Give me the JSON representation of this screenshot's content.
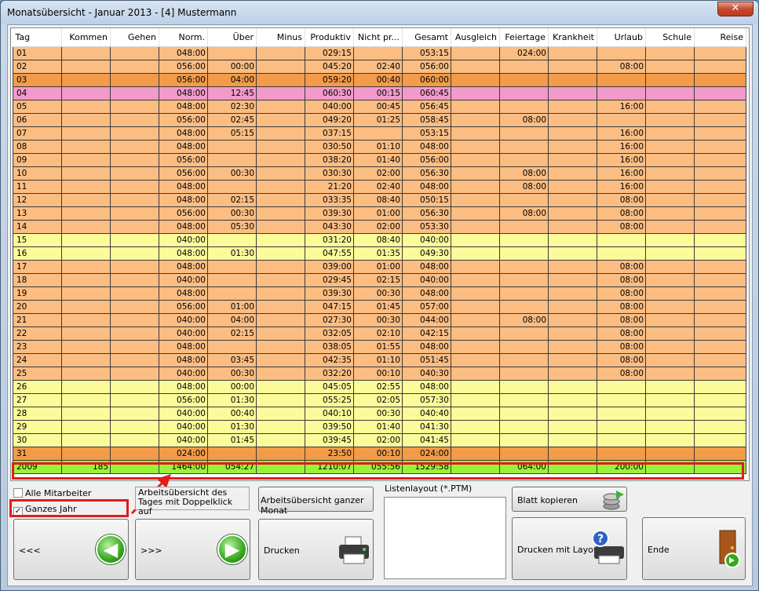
{
  "window": {
    "title": "Monatsübersicht - Januar 2013 - [4] Mustermann",
    "close_label": "✕"
  },
  "columns": [
    "Tag",
    "Kommen",
    "Gehen",
    "Norm.",
    "Über",
    "Minus",
    "Produktiv",
    "Nicht pr...",
    "Gesamt",
    "Ausgleich",
    "Feiertage",
    "Krankheit",
    "Urlaub",
    "Schule",
    "Reise"
  ],
  "rows": [
    {
      "color": "orange",
      "cells": [
        "01",
        "",
        "",
        "048:00",
        "",
        "",
        "029:15",
        "",
        "053:15",
        "",
        "024:00",
        "",
        "",
        "",
        ""
      ]
    },
    {
      "color": "orange",
      "cells": [
        "02",
        "",
        "",
        "056:00",
        "00:00",
        "",
        "045:20",
        "02:40",
        "056:00",
        "",
        "",
        "",
        "08:00",
        "",
        ""
      ]
    },
    {
      "color": "dark",
      "cells": [
        "03",
        "",
        "",
        "056:00",
        "04:00",
        "",
        "059:20",
        "00:40",
        "060:00",
        "",
        "",
        "",
        "",
        "",
        ""
      ]
    },
    {
      "color": "pink",
      "cells": [
        "04",
        "",
        "",
        "048:00",
        "12:45",
        "",
        "060:30",
        "00:15",
        "060:45",
        "",
        "",
        "",
        "",
        "",
        ""
      ]
    },
    {
      "color": "orange",
      "cells": [
        "05",
        "",
        "",
        "048:00",
        "02:30",
        "",
        "040:00",
        "00:45",
        "056:45",
        "",
        "",
        "",
        "16:00",
        "",
        ""
      ]
    },
    {
      "color": "orange",
      "cells": [
        "06",
        "",
        "",
        "056:00",
        "02:45",
        "",
        "049:20",
        "01:25",
        "058:45",
        "",
        "08:00",
        "",
        "",
        "",
        ""
      ]
    },
    {
      "color": "orange",
      "cells": [
        "07",
        "",
        "",
        "048:00",
        "05:15",
        "",
        "037:15",
        "",
        "053:15",
        "",
        "",
        "",
        "16:00",
        "",
        ""
      ]
    },
    {
      "color": "orange",
      "cells": [
        "08",
        "",
        "",
        "048:00",
        "",
        "",
        "030:50",
        "01:10",
        "048:00",
        "",
        "",
        "",
        "16:00",
        "",
        ""
      ]
    },
    {
      "color": "orange",
      "cells": [
        "09",
        "",
        "",
        "056:00",
        "",
        "",
        "038:20",
        "01:40",
        "056:00",
        "",
        "",
        "",
        "16:00",
        "",
        ""
      ]
    },
    {
      "color": "orange",
      "cells": [
        "10",
        "",
        "",
        "056:00",
        "00:30",
        "",
        "030:30",
        "02:00",
        "056:30",
        "",
        "08:00",
        "",
        "16:00",
        "",
        ""
      ]
    },
    {
      "color": "orange",
      "cells": [
        "11",
        "",
        "",
        "048:00",
        "",
        "",
        "21:20",
        "02:40",
        "048:00",
        "",
        "08:00",
        "",
        "16:00",
        "",
        ""
      ]
    },
    {
      "color": "orange",
      "cells": [
        "12",
        "",
        "",
        "048:00",
        "02:15",
        "",
        "033:35",
        "08:40",
        "050:15",
        "",
        "",
        "",
        "08:00",
        "",
        ""
      ]
    },
    {
      "color": "orange",
      "cells": [
        "13",
        "",
        "",
        "056:00",
        "00:30",
        "",
        "039:30",
        "01:00",
        "056:30",
        "",
        "08:00",
        "",
        "08:00",
        "",
        ""
      ]
    },
    {
      "color": "orange",
      "cells": [
        "14",
        "",
        "",
        "048:00",
        "05:30",
        "",
        "043:30",
        "02:00",
        "053:30",
        "",
        "",
        "",
        "08:00",
        "",
        ""
      ]
    },
    {
      "color": "yellow",
      "cells": [
        "15",
        "",
        "",
        "040:00",
        "",
        "",
        "031:20",
        "08:40",
        "040:00",
        "",
        "",
        "",
        "",
        "",
        ""
      ]
    },
    {
      "color": "yellow",
      "cells": [
        "16",
        "",
        "",
        "048:00",
        "01:30",
        "",
        "047:55",
        "01:35",
        "049:30",
        "",
        "",
        "",
        "",
        "",
        ""
      ]
    },
    {
      "color": "orange",
      "cells": [
        "17",
        "",
        "",
        "048:00",
        "",
        "",
        "039:00",
        "01:00",
        "048:00",
        "",
        "",
        "",
        "08:00",
        "",
        ""
      ]
    },
    {
      "color": "orange",
      "cells": [
        "18",
        "",
        "",
        "040:00",
        "",
        "",
        "029:45",
        "02:15",
        "040:00",
        "",
        "",
        "",
        "08:00",
        "",
        ""
      ]
    },
    {
      "color": "orange",
      "cells": [
        "19",
        "",
        "",
        "048:00",
        "",
        "",
        "039:30",
        "00:30",
        "048:00",
        "",
        "",
        "",
        "08:00",
        "",
        ""
      ]
    },
    {
      "color": "orange",
      "cells": [
        "20",
        "",
        "",
        "056:00",
        "01:00",
        "",
        "047:15",
        "01:45",
        "057:00",
        "",
        "",
        "",
        "08:00",
        "",
        ""
      ]
    },
    {
      "color": "orange",
      "cells": [
        "21",
        "",
        "",
        "040:00",
        "04:00",
        "",
        "027:30",
        "00:30",
        "044:00",
        "",
        "08:00",
        "",
        "08:00",
        "",
        ""
      ]
    },
    {
      "color": "orange",
      "cells": [
        "22",
        "",
        "",
        "040:00",
        "02:15",
        "",
        "032:05",
        "02:10",
        "042:15",
        "",
        "",
        "",
        "08:00",
        "",
        ""
      ]
    },
    {
      "color": "orange",
      "cells": [
        "23",
        "",
        "",
        "048:00",
        "",
        "",
        "038:05",
        "01:55",
        "048:00",
        "",
        "",
        "",
        "08:00",
        "",
        ""
      ]
    },
    {
      "color": "orange",
      "cells": [
        "24",
        "",
        "",
        "048:00",
        "03:45",
        "",
        "042:35",
        "01:10",
        "051:45",
        "",
        "",
        "",
        "08:00",
        "",
        ""
      ]
    },
    {
      "color": "orange",
      "cells": [
        "25",
        "",
        "",
        "040:00",
        "00:30",
        "",
        "032:20",
        "00:10",
        "040:30",
        "",
        "",
        "",
        "08:00",
        "",
        ""
      ]
    },
    {
      "color": "yellow",
      "cells": [
        "26",
        "",
        "",
        "048:00",
        "00:00",
        "",
        "045:05",
        "02:55",
        "048:00",
        "",
        "",
        "",
        "",
        "",
        ""
      ]
    },
    {
      "color": "yellow",
      "cells": [
        "27",
        "",
        "",
        "056:00",
        "01:30",
        "",
        "055:25",
        "02:05",
        "057:30",
        "",
        "",
        "",
        "",
        "",
        ""
      ]
    },
    {
      "color": "yellow",
      "cells": [
        "28",
        "",
        "",
        "040:00",
        "00:40",
        "",
        "040:10",
        "00:30",
        "040:40",
        "",
        "",
        "",
        "",
        "",
        ""
      ]
    },
    {
      "color": "yellow",
      "cells": [
        "29",
        "",
        "",
        "040:00",
        "01:30",
        "",
        "039:50",
        "01:40",
        "041:30",
        "",
        "",
        "",
        "",
        "",
        ""
      ]
    },
    {
      "color": "yellow",
      "cells": [
        "30",
        "",
        "",
        "040:00",
        "01:45",
        "",
        "039:45",
        "02:00",
        "041:45",
        "",
        "",
        "",
        "",
        "",
        ""
      ]
    },
    {
      "color": "dark",
      "cells": [
        "31",
        "",
        "",
        "024:00",
        "",
        "",
        "23:50",
        "00:10",
        "024:00",
        "",
        "",
        "",
        "",
        "",
        ""
      ]
    }
  ],
  "total_row": {
    "color": "total",
    "cells": [
      "2009",
      "185",
      "",
      "1464:00",
      "054:27",
      "",
      "1210:07",
      "055:56",
      "1529:58",
      "",
      "064:00",
      "",
      "200:00",
      "",
      ""
    ]
  },
  "controls": {
    "alle_mitarbeiter": {
      "label": "Alle Mitarbeiter",
      "checked": false
    },
    "ganzes_jahr": {
      "label": "Ganzes Jahr",
      "checked": true,
      "check_mark": "✓"
    },
    "info_text": "Arbeitsübersicht des Tages mit Doppelklick auf",
    "prev_label": "<<<",
    "next_label": ">>>",
    "month_overview_label": "Arbeitsübersicht ganzer Monat",
    "print_label": "Drucken",
    "list_layout_label": "Listenlayout (*.PTM)",
    "copy_sheet_label": "Blatt kopieren",
    "print_layout_label": "Drucken mit Layout",
    "end_label": "Ende",
    "prev_icon": "◀",
    "next_icon": "▶"
  }
}
